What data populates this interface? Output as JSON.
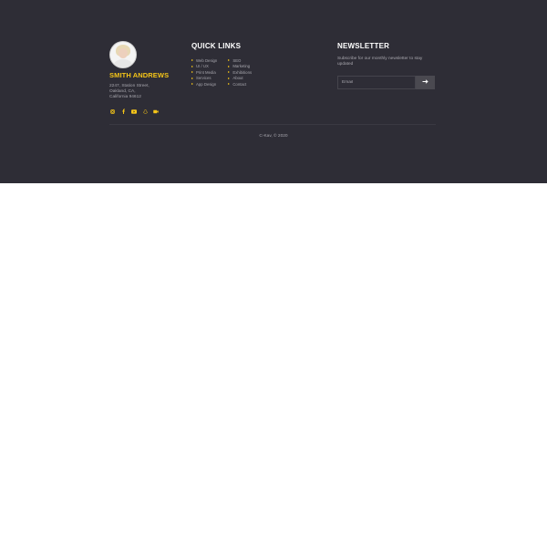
{
  "profile": {
    "name": "SMITH ANDREWS",
    "address": [
      "2247, Station Street,",
      "Oakland, CA,",
      "California 94612"
    ]
  },
  "socials": [
    {
      "icon": "instagram-icon"
    },
    {
      "icon": "facebook-icon"
    },
    {
      "icon": "youtube-icon"
    },
    {
      "icon": "snapchat-icon"
    },
    {
      "icon": "video-icon"
    }
  ],
  "quick_links": {
    "heading": "QUICK LINKS",
    "column1": [
      "Web Design",
      "UI / UX",
      "Print Media",
      "Services",
      "App Design"
    ],
    "column2": [
      "SEO",
      "Marketing",
      "Exhibitions",
      "About",
      "Contact"
    ]
  },
  "newsletter": {
    "heading": "NEWSLETTER",
    "text": "Subscribe for our monthly newsletter to stay updated",
    "email_placeholder": "Email",
    "submit_icon": "arrow-right-icon"
  },
  "copyright": "C-Kav, © 2020",
  "colors": {
    "footer_bg": "#2e2d36",
    "accent": "#f5c518",
    "muted_text": "#a7a6ad"
  }
}
